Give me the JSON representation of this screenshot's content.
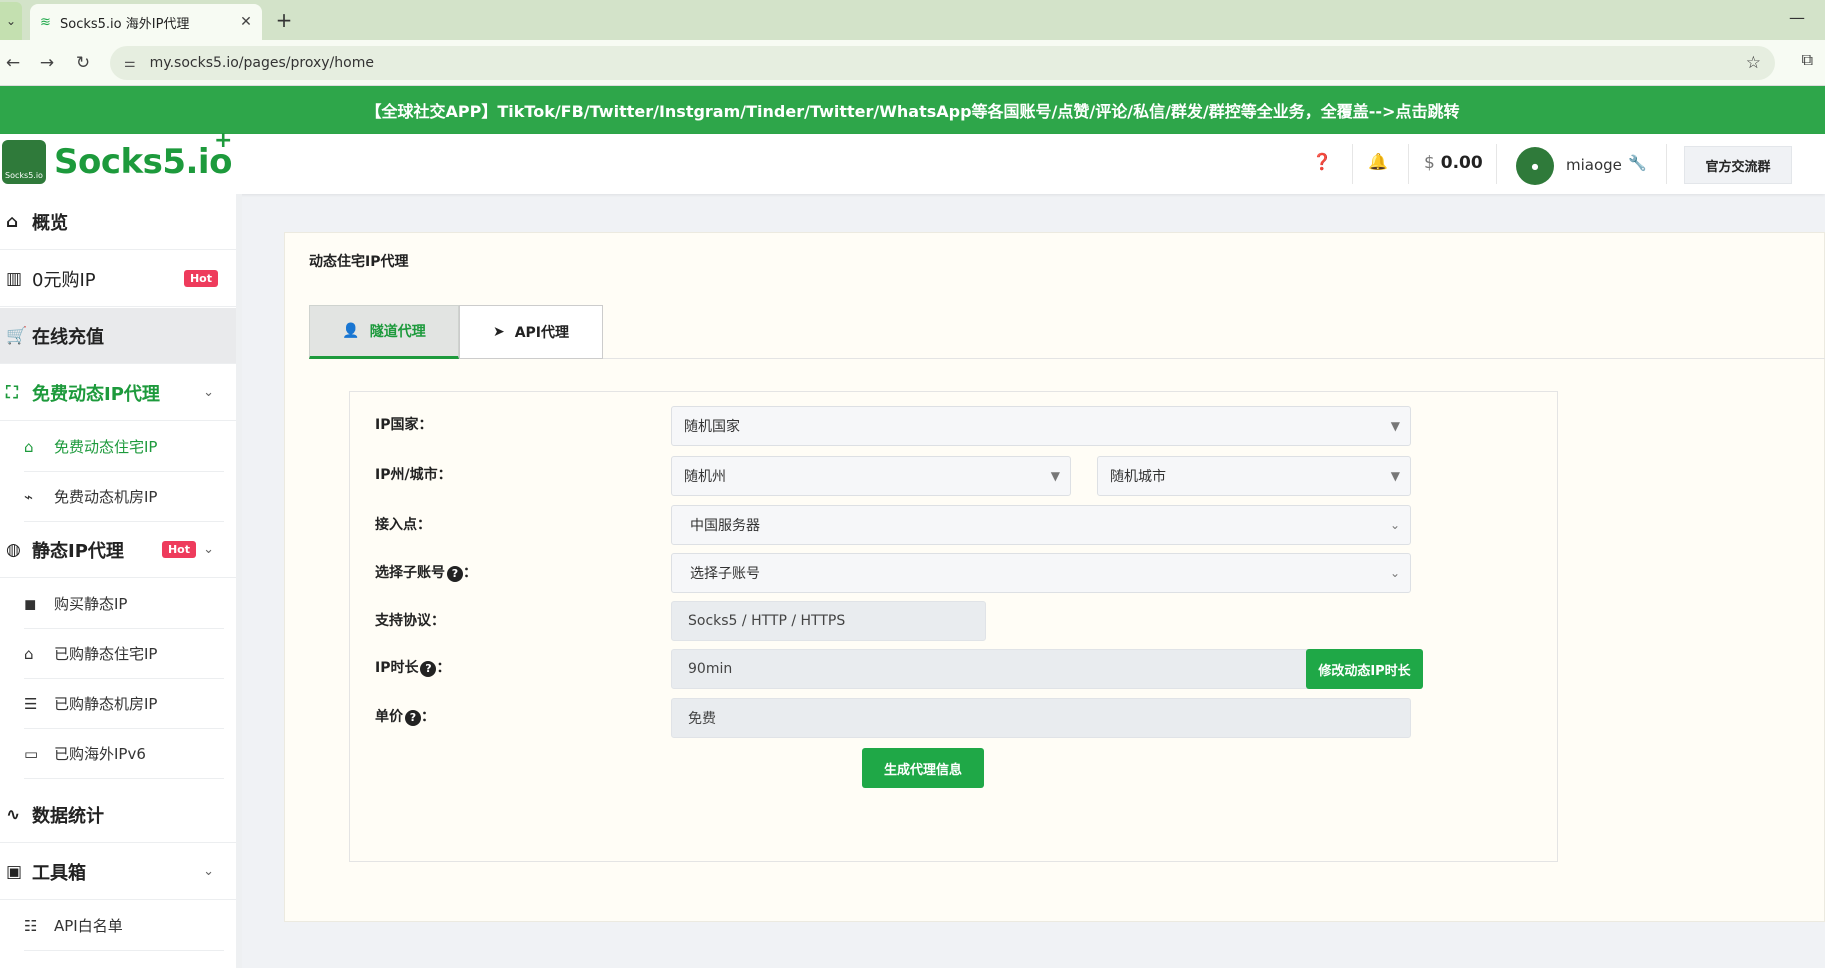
{
  "browser": {
    "tab_title": "Socks5.io 海外IP代理",
    "close": "✕",
    "new_tab": "+",
    "menu": "⌄",
    "minimize": "—",
    "url": "my.socks5.io/pages/proxy/home",
    "back": "←",
    "forward": "→",
    "reload": "↻",
    "star": "☆"
  },
  "banner": {
    "text": "【全球社交APP】TikTok/FB/Twitter/Instgram/Tinder/Twitter/WhatsApp等各国账号/点赞/评论/私信/群发/群控等全业务，全覆盖-->点击跳转"
  },
  "header": {
    "logo_text": "Socks5.io",
    "logo_plus": "+",
    "logo_badge": "Socks5.io",
    "currency": "$",
    "balance": "0.00",
    "username": "miaoge",
    "group_button": "官方交流群"
  },
  "sidebar": {
    "items": [
      {
        "label": "概览"
      },
      {
        "label": "0元购IP",
        "badge": "Hot"
      },
      {
        "label": "在线充值"
      },
      {
        "label": "免费动态IP代理"
      },
      {
        "label": "静态IP代理",
        "badge": "Hot"
      },
      {
        "label": "数据统计"
      },
      {
        "label": "工具箱"
      }
    ],
    "subitems": [
      {
        "label": "免费动态住宅IP"
      },
      {
        "label": "免费动态机房IP"
      },
      {
        "label": "购买静态IP"
      },
      {
        "label": "已购静态住宅IP"
      },
      {
        "label": "已购静态机房IP"
      },
      {
        "label": "已购海外IPv6"
      },
      {
        "label": "API白名单"
      }
    ]
  },
  "main": {
    "title": "动态住宅IP代理",
    "tabs": [
      {
        "label": "隧道代理"
      },
      {
        "label": "API代理"
      }
    ],
    "form": {
      "country_label": "IP国家：",
      "country_value": "随机国家",
      "region_label": "IP州/城市：",
      "state_value": "随机州",
      "city_value": "随机城市",
      "access_label": "接入点：",
      "access_value": "中国服务器",
      "subaccount_label": "选择子账号",
      "subaccount_value": "选择子账号",
      "protocol_label": "支持协议：",
      "protocol_value": "Socks5 / HTTP / HTTPS",
      "duration_label": "IP时长",
      "duration_value": "90min",
      "duration_button": "修改动态IP时长",
      "price_label": "单价",
      "price_value": "免费",
      "colon": "：",
      "generate_button": "生成代理信息"
    }
  },
  "colors": {
    "brand_green": "#1d9a3c",
    "banner_green": "#2ea64a",
    "hot_red": "#ee3b5c"
  }
}
